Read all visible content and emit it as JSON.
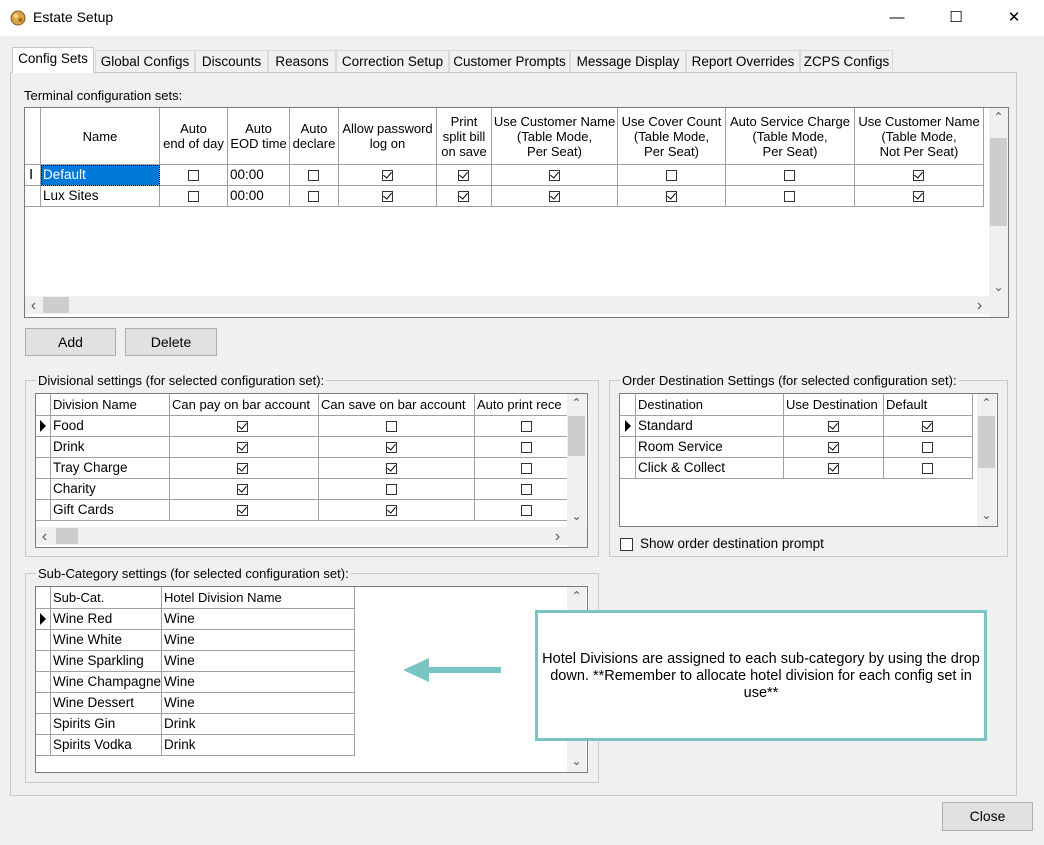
{
  "window": {
    "title": "Estate Setup",
    "minimize": "—",
    "maximize": "☐",
    "close": "✕"
  },
  "tabs": [
    "Config Sets",
    "Global Configs",
    "Discounts",
    "Reasons",
    "Correction Setup",
    "Customer Prompts",
    "Message Display",
    "Report Overrides",
    "ZCPS Configs"
  ],
  "terminal": {
    "label": "Terminal configuration sets:",
    "columns": [
      "Name",
      "Auto end of day",
      "Auto EOD time",
      "Auto declare",
      "Allow password log on",
      "Print split bill on save",
      "Use Customer Name (Table Mode, Per Seat)",
      "Use Cover Count (Table Mode, Per Seat)",
      "Auto Service Charge (Table Mode, Per Seat)",
      "Use Customer Name (Table Mode, Not Per Seat)"
    ],
    "header_lines": [
      [
        "Name"
      ],
      [
        "Auto",
        "end of day"
      ],
      [
        "Auto",
        "EOD time"
      ],
      [
        "Auto",
        "declare"
      ],
      [
        "Allow password",
        "log on"
      ],
      [
        "Print",
        "split bill",
        "on save"
      ],
      [
        "Use Customer Name",
        "(Table Mode,",
        "Per Seat)"
      ],
      [
        "Use Cover Count",
        "(Table Mode,",
        "Per Seat)"
      ],
      [
        "Auto Service Charge",
        "(Table Mode,",
        "Per Seat)"
      ],
      [
        "Use Customer Name",
        "(Table Mode,",
        "Not Per Seat)"
      ]
    ],
    "rows": [
      {
        "name": "Default",
        "time": "00:00",
        "checks": [
          false,
          false,
          true,
          true,
          true,
          false,
          false,
          true
        ]
      },
      {
        "name": "Lux Sites",
        "time": "00:00",
        "checks": [
          false,
          false,
          true,
          true,
          true,
          true,
          false,
          true
        ]
      }
    ],
    "add_label": "Add",
    "delete_label": "Delete"
  },
  "divisional": {
    "label": "Divisional settings (for selected configuration set):",
    "columns": [
      "Division Name",
      "Can pay on bar account",
      "Can save on bar account",
      "Auto print rece"
    ],
    "rows": [
      {
        "name": "Food",
        "checks": [
          true,
          false,
          false
        ]
      },
      {
        "name": "Drink",
        "checks": [
          true,
          true,
          false
        ]
      },
      {
        "name": "Tray Charge",
        "checks": [
          true,
          true,
          false
        ]
      },
      {
        "name": "Charity",
        "checks": [
          true,
          false,
          false
        ]
      },
      {
        "name": "Gift Cards",
        "checks": [
          true,
          true,
          false
        ]
      }
    ]
  },
  "destination": {
    "label": "Order Destination Settings (for selected configuration set):",
    "columns": [
      "Destination",
      "Use Destination",
      "Default"
    ],
    "rows": [
      {
        "name": "Standard",
        "checks": [
          true,
          true
        ]
      },
      {
        "name": "Room Service",
        "checks": [
          true,
          false
        ]
      },
      {
        "name": "Click & Collect",
        "checks": [
          true,
          false
        ]
      }
    ],
    "prompt_label": "Show order destination prompt",
    "prompt_checked": false
  },
  "subcat": {
    "label": "Sub-Category settings (for selected configuration set):",
    "columns": [
      "Sub-Cat.",
      "Hotel Division Name"
    ],
    "rows": [
      {
        "name": "Wine Red",
        "division": "Wine"
      },
      {
        "name": "Wine White",
        "division": "Wine"
      },
      {
        "name": "Wine Sparkling",
        "division": "Wine"
      },
      {
        "name": "Wine Champagne",
        "division": "Wine"
      },
      {
        "name": "Wine Dessert",
        "division": "Wine"
      },
      {
        "name": "Spirits Gin",
        "division": "Drink"
      },
      {
        "name": "Spirits Vodka",
        "division": "Drink"
      }
    ]
  },
  "callout": {
    "text": "Hotel Divisions are assigned to each sub-category by using the drop down.  **Remember to allocate hotel division for each config set in use**",
    "border_color": "#7bc4c4"
  },
  "close_label": "Close",
  "colors": {
    "selection": "#0078d7",
    "arrow": "#7bc4c4"
  }
}
